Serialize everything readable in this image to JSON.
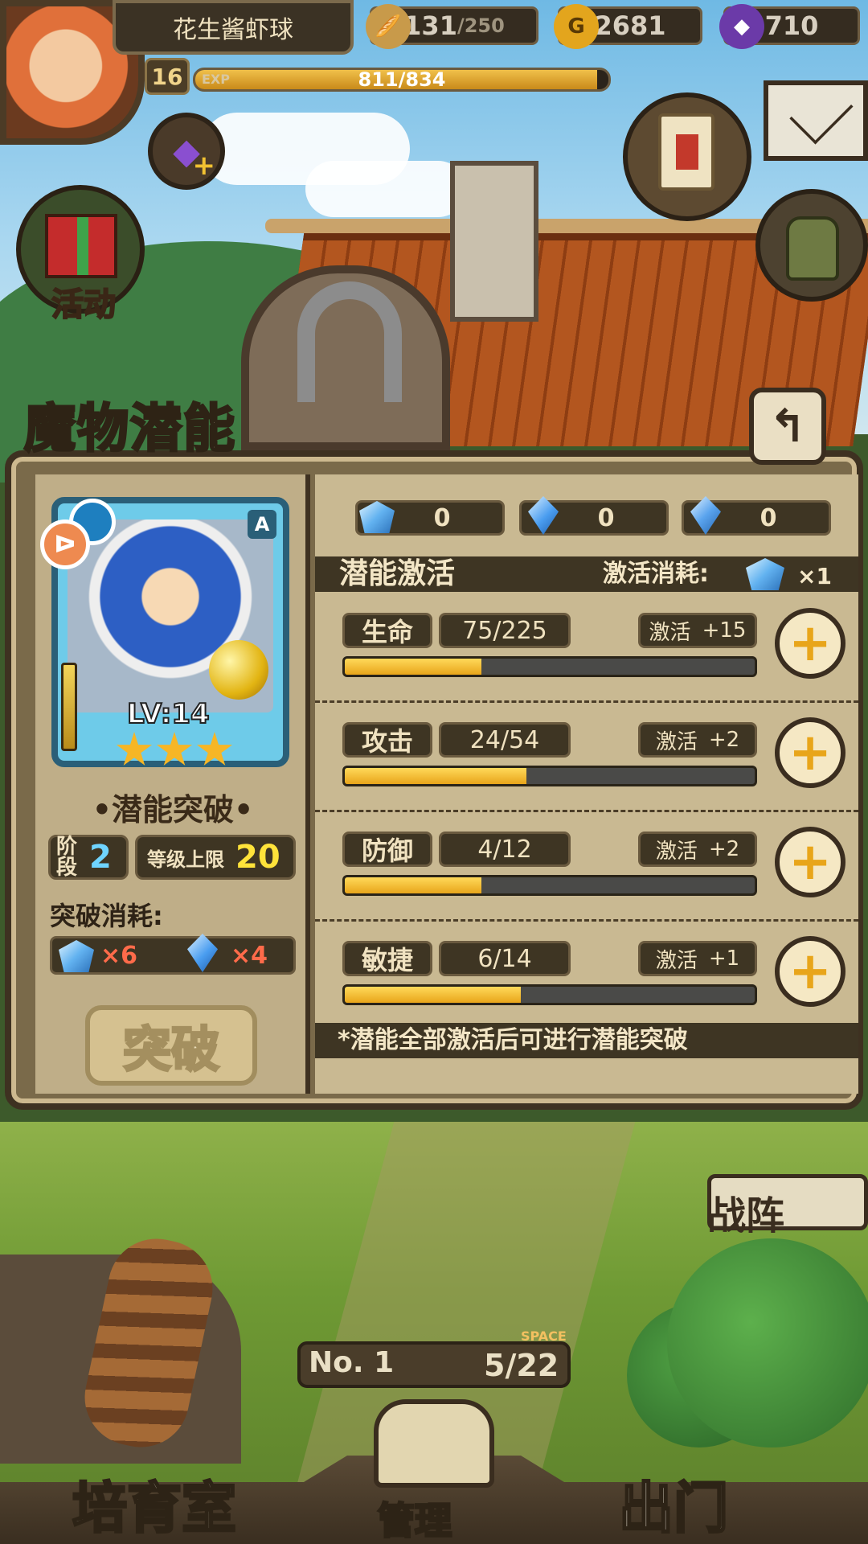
{
  "hud": {
    "player_name": "花生酱虾球",
    "level": "16",
    "exp_tag": "EXP",
    "exp_text": "811/834",
    "exp_fraction": 0.972,
    "stamina": "131",
    "stamina_max": "/250",
    "gold": "2681",
    "gold_icon": "G",
    "gems": "710"
  },
  "side": {
    "event_label": "活动"
  },
  "panel": {
    "title": "魔物潜能",
    "back_icon": "↰",
    "monster": {
      "rarity": "A",
      "level": "LV:14",
      "stars": 3
    },
    "breakthrough": {
      "title": "•潜能突破•",
      "stage_label": "阶段",
      "stage_value": "2",
      "cap_label": "等级上限",
      "cap_value": "20",
      "cost_label": "突破消耗:",
      "cost_crystal": "×6",
      "cost_gem": "×4",
      "button": "突破"
    },
    "resources": [
      {
        "icon": "blue-crystal-cluster-icon",
        "value": "0"
      },
      {
        "icon": "blue-shard-icon",
        "value": "0"
      },
      {
        "icon": "blue-gem-icon",
        "value": "0"
      }
    ],
    "activation": {
      "title": "潜能激活",
      "cost_label": "激活消耗:",
      "cost_qty": "×1"
    },
    "stats": [
      {
        "label": "生命",
        "value": "75/225",
        "bonus_label": "激活",
        "bonus": "+15",
        "fraction": 0.333
      },
      {
        "label": "攻击",
        "value": "24/54",
        "bonus_label": "激活",
        "bonus": "+2",
        "fraction": 0.444
      },
      {
        "label": "防御",
        "value": "4/12",
        "bonus_label": "激活",
        "bonus": "+2",
        "fraction": 0.333
      },
      {
        "label": "敏捷",
        "value": "6/14",
        "bonus_label": "激活",
        "bonus": "+1",
        "fraction": 0.429
      }
    ],
    "note": "*潜能全部激活后可进行潜能突破"
  },
  "bottom": {
    "formation": "战阵",
    "no_label": "No. 1",
    "space_tag": "SPACE",
    "space_value": "5/22",
    "nursery": "培育室",
    "manage": "管理",
    "go_out": "出门"
  },
  "colors": {
    "bar_fill": "#e8a51a",
    "panel_bg": "#c9b992",
    "dark_chip": "#3e3523"
  }
}
